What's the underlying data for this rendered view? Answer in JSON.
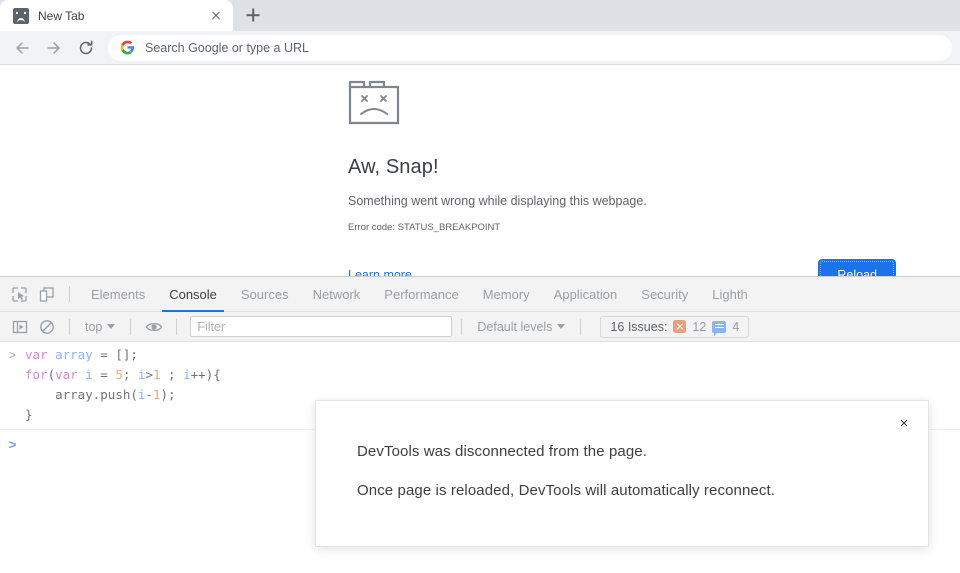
{
  "browser": {
    "tab": {
      "title": "New Tab",
      "favicon": "sad-tab-icon",
      "close_icon": "close-icon"
    },
    "new_tab_button": "new-tab-icon",
    "nav": {
      "back": "back-arrow-icon",
      "forward": "forward-arrow-icon",
      "reload": "reload-icon"
    },
    "omnibox": {
      "logo": "google-g-icon",
      "placeholder": "Search Google or type a URL",
      "value": ""
    }
  },
  "error_page": {
    "icon": "sad-folder-icon",
    "title": "Aw, Snap!",
    "subtitle": "Something went wrong while displaying this webpage.",
    "error_code": "Error code: STATUS_BREAKPOINT",
    "learn_more": "Learn more",
    "reload_button": "Reload",
    "accent_color": "#1a73e8"
  },
  "devtools": {
    "inspect_icon": "inspect-element-icon",
    "device_icon": "device-toolbar-icon",
    "tabs": [
      {
        "label": "Elements",
        "active": false
      },
      {
        "label": "Console",
        "active": true
      },
      {
        "label": "Sources",
        "active": false
      },
      {
        "label": "Network",
        "active": false
      },
      {
        "label": "Performance",
        "active": false
      },
      {
        "label": "Memory",
        "active": false
      },
      {
        "label": "Application",
        "active": false
      },
      {
        "label": "Security",
        "active": false
      },
      {
        "label": "Lighth",
        "active": false
      }
    ],
    "active_tab_underline_color": "#1a73e8",
    "filterbar": {
      "sidebar_icon": "console-sidebar-icon",
      "clear_icon": "clear-console-icon",
      "context": "top",
      "eye_icon": "live-expression-icon",
      "filter_placeholder": "Filter",
      "filter_value": "",
      "levels": "Default levels",
      "issues_label": "16 Issues:",
      "issue_error_count": "12",
      "issue_info_count": "4",
      "issue_error_color": "#e9a07a",
      "issue_info_color": "#8ab4f8"
    },
    "console": {
      "entry_prompt": ">",
      "code_lines": [
        [
          {
            "t": "var ",
            "c": "kw"
          },
          {
            "t": "array ",
            "c": "id"
          },
          {
            "t": "= [];",
            "c": "pl"
          }
        ],
        [
          {
            "t": "for",
            "c": "kw"
          },
          {
            "t": "(",
            "c": "pl"
          },
          {
            "t": "var ",
            "c": "kw"
          },
          {
            "t": "i ",
            "c": "id"
          },
          {
            "t": "= ",
            "c": "pl"
          },
          {
            "t": "5",
            "c": "num"
          },
          {
            "t": "; ",
            "c": "pl"
          },
          {
            "t": "i",
            "c": "id"
          },
          {
            "t": ">",
            "c": "pl"
          },
          {
            "t": "1",
            "c": "num"
          },
          {
            "t": " ; ",
            "c": "pl"
          },
          {
            "t": "i",
            "c": "id"
          },
          {
            "t": "++){",
            "c": "pl"
          }
        ],
        [
          {
            "t": "    array.push(",
            "c": "pl"
          },
          {
            "t": "i",
            "c": "id"
          },
          {
            "t": "-",
            "c": "pl"
          },
          {
            "t": "1",
            "c": "num"
          },
          {
            "t": ");",
            "c": "pl"
          }
        ],
        [
          {
            "t": "}",
            "c": "pl"
          }
        ]
      ],
      "new_prompt": ">"
    }
  },
  "dialog": {
    "line1": "DevTools was disconnected from the page.",
    "line2": "Once page is reloaded, DevTools will automatically reconnect.",
    "close_icon": "×"
  }
}
